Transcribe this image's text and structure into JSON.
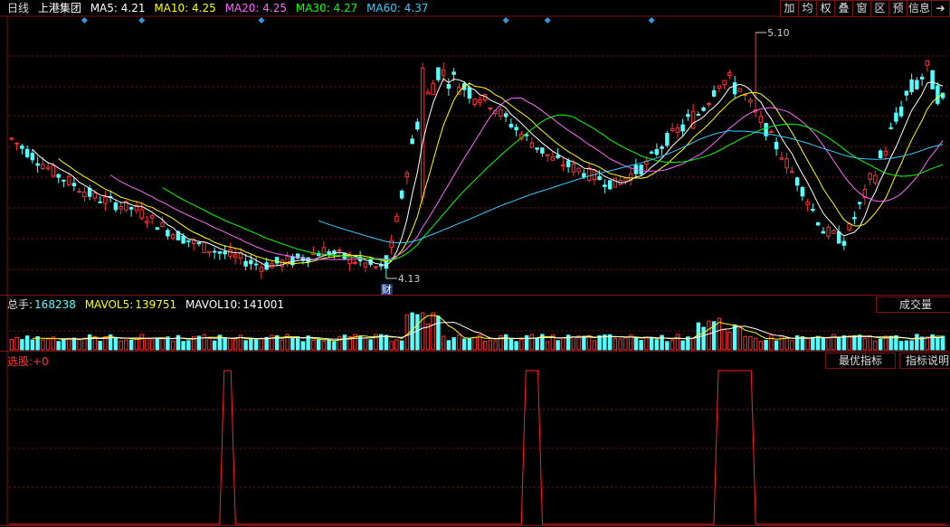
{
  "header": {
    "period": "日线",
    "stock_name": "上港集团",
    "ma": [
      {
        "label": "MA5:",
        "value": "4.21",
        "color": "#ffffff"
      },
      {
        "label": "MA10:",
        "value": "4.25",
        "color": "#ffff00"
      },
      {
        "label": "MA20:",
        "value": "4.25",
        "color": "#ff66ff"
      },
      {
        "label": "MA30:",
        "value": "4.27",
        "color": "#00ff00"
      },
      {
        "label": "MA60:",
        "value": "4.37",
        "color": "#33ccff"
      }
    ]
  },
  "toolbar": {
    "add": "加",
    "avg": "均",
    "rights": "权",
    "overlay": "叠",
    "window": "窗",
    "range": "区",
    "forecast": "预",
    "info": "信息"
  },
  "volume_header": {
    "total_label": "总手:",
    "total_value": "168238",
    "mavol5_label": "MAVOL5:",
    "mavol5_value": "139751",
    "mavol10_label": "MAVOL10:",
    "mavol10_value": "141001",
    "type_button": "成交量"
  },
  "indicator_header": {
    "label": "选股:",
    "value": "+0",
    "best_button": "最优指标",
    "help_button": "指标说明"
  },
  "annotations": {
    "high_label": "5.10",
    "low_label": "4.13",
    "event_label": "财"
  },
  "colors": {
    "up": "#ff3333",
    "down": "#54ffff",
    "grid": "#7a1010",
    "signal": "#ff2020"
  },
  "chart_data": {
    "type": "candlestick",
    "high": 5.1,
    "low": 4.13,
    "signal_pulses": [
      {
        "candle_start": 41,
        "candle_end": 42
      },
      {
        "candle_start": 99,
        "candle_end": 101
      },
      {
        "candle_start": 136,
        "candle_end": 142
      }
    ]
  }
}
